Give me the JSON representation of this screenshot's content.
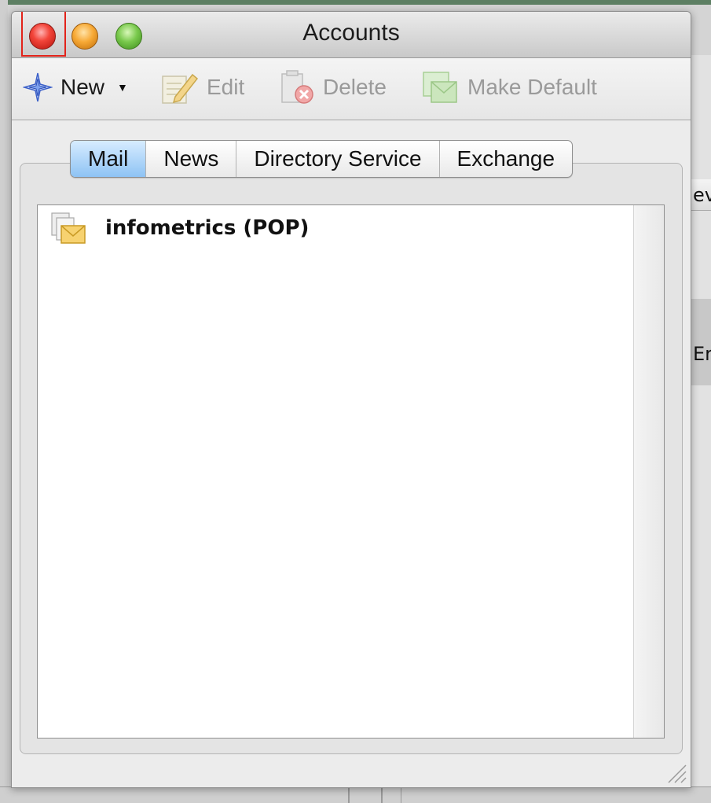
{
  "window": {
    "title": "Accounts"
  },
  "toolbar": {
    "new_label": "New",
    "edit_label": "Edit",
    "delete_label": "Delete",
    "make_default_label": "Make Default"
  },
  "tabs": [
    {
      "label": "Mail",
      "active": true
    },
    {
      "label": "News",
      "active": false
    },
    {
      "label": "Directory Service",
      "active": false
    },
    {
      "label": "Exchange",
      "active": false
    }
  ],
  "accounts": [
    {
      "name": "infometrics (POP)",
      "icon": "mail-account-icon"
    }
  ],
  "background": {
    "col_header_fragment": "ev",
    "row_fragment": "Er"
  },
  "colors": {
    "close": "#f3453a",
    "minimize": "#f7a935",
    "zoom": "#79c94c",
    "active_tab": "#8ec3f4",
    "highlight_box": "#e2231a"
  }
}
